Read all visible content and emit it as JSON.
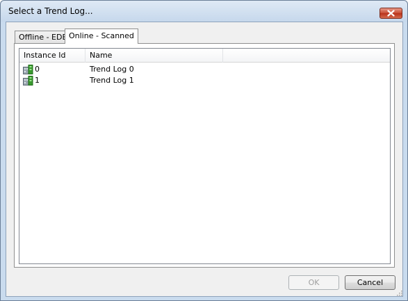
{
  "window": {
    "title": "Select a Trend Log..."
  },
  "tabs": [
    {
      "label": "Offline - EDE",
      "active": false
    },
    {
      "label": "Online - Scanned",
      "active": true
    }
  ],
  "list": {
    "columns": [
      "Instance Id",
      "Name",
      ""
    ],
    "rows": [
      {
        "icon": "trend-log-icon",
        "instance_id": "0",
        "name": "Trend Log 0"
      },
      {
        "icon": "trend-log-icon",
        "instance_id": "1",
        "name": "Trend Log 1"
      }
    ]
  },
  "buttons": {
    "ok": {
      "label": "OK",
      "enabled": false
    },
    "cancel": {
      "label": "Cancel",
      "enabled": true
    }
  },
  "icons": {
    "close": "close-icon",
    "resize": "resize-grip-icon"
  },
  "colors": {
    "titlebar": "#c9dbee",
    "close_button": "#c74b32",
    "panel_background": "#f0f0f0"
  }
}
